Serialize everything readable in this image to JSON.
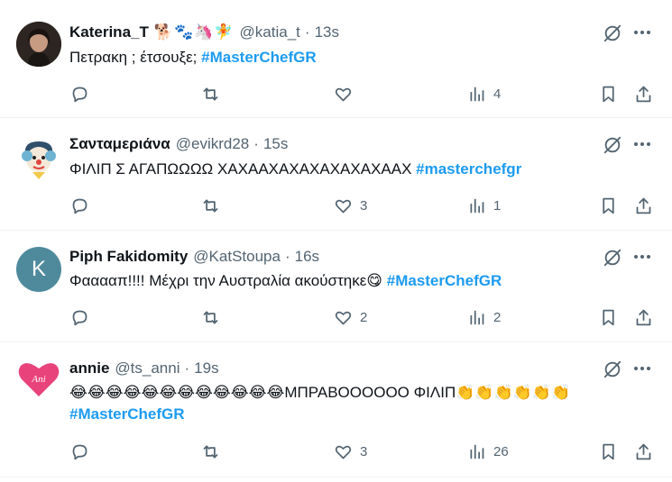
{
  "tweets": [
    {
      "display_name": "Katerina_T",
      "name_emojis": "🐕🐾🦄🧚",
      "handle": "@katia_t",
      "separator": "·",
      "time": "13s",
      "text_prefix": "Πετρακη ; έτσουξε; ",
      "hashtag": "#MasterChefGR",
      "replies": "",
      "reposts": "",
      "likes": "",
      "views": "4",
      "avatar": {
        "type": "photo",
        "bg": "#3a2f2a",
        "accent": "#8a6b57"
      }
    },
    {
      "display_name": "Σανταμεριάνα",
      "name_emojis": "",
      "handle": "@evikrd28",
      "separator": "·",
      "time": "15s",
      "text_prefix": "ΦΙΛΙΠ Σ ΑΓΑΠΩΩΩΩ ΧΑΧΑΑΧΑΧΑΧΑΧΑΧΑΧΑΑΧ ",
      "hashtag": "#masterchefgr",
      "replies": "",
      "reposts": "",
      "likes": "3",
      "views": "1",
      "avatar": {
        "type": "clown",
        "bg": "#ffffff",
        "accent": "#6fb3d2"
      }
    },
    {
      "display_name": "Piph Fakidomity",
      "name_emojis": "",
      "handle": "@KatStoupa",
      "separator": "·",
      "time": "16s",
      "text_prefix": "Φααααπ!!!! Μέχρι την Αυστραλία ακούστηκε😋 ",
      "hashtag": "#MasterChefGR",
      "replies": "",
      "reposts": "",
      "likes": "2",
      "views": "2",
      "avatar": {
        "type": "letter",
        "letter": "K",
        "bg": "#4f8a9c",
        "accent": "#ffffff"
      }
    },
    {
      "display_name": "annie",
      "name_emojis": "",
      "handle": "@ts_anni",
      "separator": "·",
      "time": "19s",
      "text_prefix": "😂😂😂😂😂😂😂😂😂😂😂😂ΜΠΡΑΒΟΟΟΟΟΟ ΦΙΛΙΠ👏👏👏👏👏👏 ",
      "hashtag": "#MasterChefGR",
      "replies": "",
      "reposts": "",
      "likes": "3",
      "views": "26",
      "avatar": {
        "type": "heart",
        "letter": "Ani",
        "bg": "#ffffff",
        "accent": "#e8437a"
      }
    }
  ],
  "icons": {
    "grok": "grok-icon",
    "more": "more-icon",
    "reply": "reply-icon",
    "repost": "repost-icon",
    "like": "like-icon",
    "views": "views-icon",
    "bookmark": "bookmark-icon",
    "share": "share-icon"
  },
  "colors": {
    "hashtag": "#1d9bf0",
    "muted": "#536471",
    "text": "#0f1419",
    "divider": "#eff3f4"
  }
}
